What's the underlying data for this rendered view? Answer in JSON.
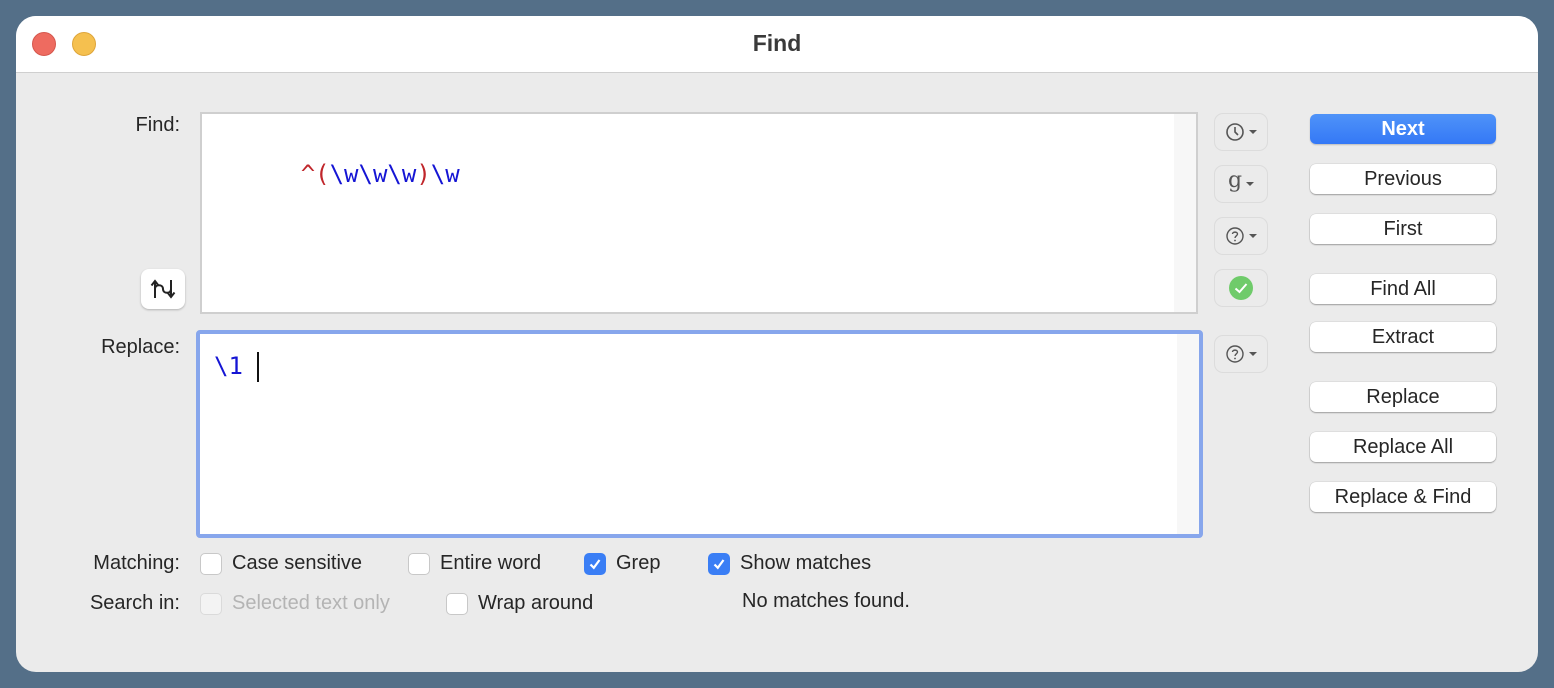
{
  "window": {
    "title": "Find",
    "close_icon": "close-traffic-light",
    "minimize_icon": "minimize-traffic-light"
  },
  "find": {
    "label": "Find:",
    "tokens": [
      {
        "text": "^(",
        "color": "#c0262b"
      },
      {
        "text": "\\w\\w\\w",
        "color": "#1515d4"
      },
      {
        "text": ")",
        "color": "#c0262b"
      },
      {
        "text": "\\w",
        "color": "#1515d4"
      }
    ],
    "swap_icon": "swap-arrows-icon"
  },
  "replace": {
    "label": "Replace:",
    "value": "\\1",
    "value_color": "#1515d4"
  },
  "side_icons": {
    "history": "clock-icon",
    "grep_patterns": "g-icon",
    "find_help": "help-icon",
    "valid": "checkmark-circle-icon",
    "replace_help": "help-icon",
    "valid_color": "#6fcb6a"
  },
  "buttons": {
    "next": "Next",
    "previous": "Previous",
    "first": "First",
    "find_all": "Find All",
    "extract": "Extract",
    "replace": "Replace",
    "replace_all": "Replace All",
    "replace_and_find": "Replace & Find",
    "accent_color": "#3478f6"
  },
  "matching": {
    "label": "Matching:",
    "options": [
      {
        "label": "Case sensitive",
        "checked": false
      },
      {
        "label": "Entire word",
        "checked": false
      },
      {
        "label": "Grep",
        "checked": true
      },
      {
        "label": "Show matches",
        "checked": true
      }
    ]
  },
  "search_in": {
    "label": "Search in:",
    "options": [
      {
        "label": "Selected text only",
        "checked": false,
        "disabled": true
      },
      {
        "label": "Wrap around",
        "checked": false,
        "disabled": false
      }
    ]
  },
  "status": "No matches found."
}
